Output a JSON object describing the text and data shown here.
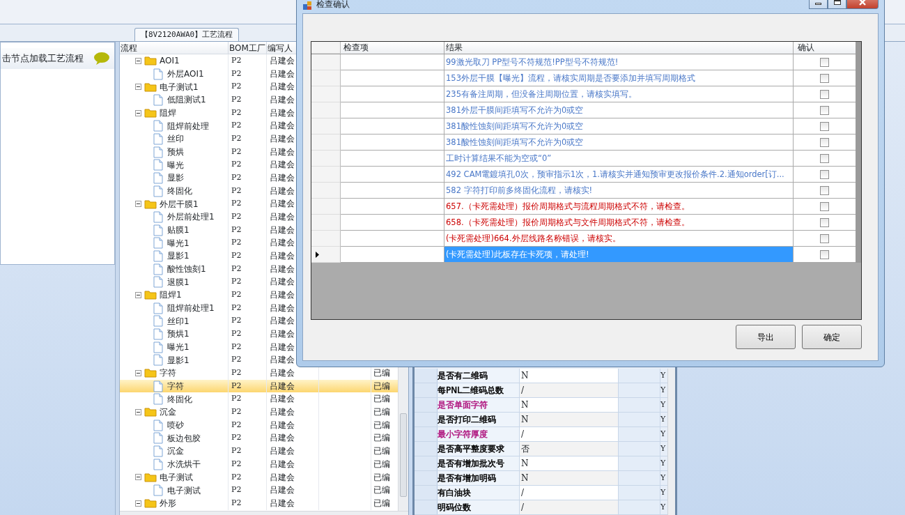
{
  "app": {
    "flow_tab": "【8V2120AWA0】工艺流程",
    "hint": "击节点加载工艺流程"
  },
  "tree": {
    "columns": [
      "流程",
      "BOM工厂",
      "编写人"
    ],
    "rows": [
      {
        "label": "AOI1",
        "factory": "P2",
        "author": "吕建会",
        "expanded": true,
        "children": [
          {
            "label": "外层AOI1",
            "factory": "P2",
            "author": "吕建会",
            "selected": false
          }
        ]
      },
      {
        "label": "电子测试1",
        "factory": "P2",
        "author": "吕建会",
        "expanded": true,
        "children": [
          {
            "label": "低阻测试1",
            "factory": "P2",
            "author": "吕建会",
            "selected": false
          }
        ]
      },
      {
        "label": "阻焊",
        "factory": "P2",
        "author": "吕建会",
        "expanded": true,
        "children": [
          {
            "label": "阻焊前处理",
            "factory": "P2",
            "author": "吕建会",
            "selected": false
          },
          {
            "label": "丝印",
            "factory": "P2",
            "author": "吕建会",
            "selected": false
          },
          {
            "label": "预烘",
            "factory": "P2",
            "author": "吕建会",
            "selected": false
          },
          {
            "label": "曝光",
            "factory": "P2",
            "author": "吕建会",
            "selected": false
          },
          {
            "label": "显影",
            "factory": "P2",
            "author": "吕建会",
            "selected": false
          },
          {
            "label": "终固化",
            "factory": "P2",
            "author": "吕建会",
            "selected": false
          }
        ]
      },
      {
        "label": "外层干膜1",
        "factory": "P2",
        "author": "吕建会",
        "expanded": true,
        "children": [
          {
            "label": "外层前处理1",
            "factory": "P2",
            "author": "吕建会",
            "selected": false
          },
          {
            "label": "贴膜1",
            "factory": "P2",
            "author": "吕建会",
            "selected": false
          },
          {
            "label": "曝光1",
            "factory": "P2",
            "author": "吕建会",
            "selected": false
          },
          {
            "label": "显影1",
            "factory": "P2",
            "author": "吕建会",
            "selected": false
          },
          {
            "label": "酸性蚀刻1",
            "factory": "P2",
            "author": "吕建会",
            "selected": false
          },
          {
            "label": "退膜1",
            "factory": "P2",
            "author": "吕建会",
            "selected": false
          }
        ]
      },
      {
        "label": "阻焊1",
        "factory": "P2",
        "author": "吕建会",
        "expanded": true,
        "children": [
          {
            "label": "阻焊前处理1",
            "factory": "P2",
            "author": "吕建会",
            "selected": false
          },
          {
            "label": "丝印1",
            "factory": "P2",
            "author": "吕建会",
            "selected": false
          },
          {
            "label": "预烘1",
            "factory": "P2",
            "author": "吕建会",
            "selected": false
          },
          {
            "label": "曝光1",
            "factory": "P2",
            "author": "吕建会",
            "selected": false
          },
          {
            "label": "显影1",
            "factory": "P2",
            "author": "吕建会",
            "selected": false
          }
        ]
      },
      {
        "label": "字符",
        "factory": "P2",
        "author": "吕建会",
        "status": "已编",
        "expanded": true,
        "children": [
          {
            "label": "字符",
            "factory": "P2",
            "author": "吕建会",
            "status": "已编",
            "selected": true
          },
          {
            "label": "终固化",
            "factory": "P2",
            "author": "吕建会",
            "status": "已编",
            "selected": false
          }
        ]
      },
      {
        "label": "沉金",
        "factory": "P2",
        "author": "吕建会",
        "status": "已编",
        "expanded": true,
        "children": [
          {
            "label": "喷砂",
            "factory": "P2",
            "author": "吕建会",
            "status": "已编",
            "selected": false
          },
          {
            "label": "板边包胶",
            "factory": "P2",
            "author": "吕建会",
            "status": "已编",
            "selected": false
          },
          {
            "label": "沉金",
            "factory": "P2",
            "author": "吕建会",
            "status": "已编",
            "selected": false
          },
          {
            "label": "水洗烘干",
            "factory": "P2",
            "author": "吕建会",
            "status": "已编",
            "selected": false
          }
        ]
      },
      {
        "label": "电子测试",
        "factory": "P2",
        "author": "吕建会",
        "status": "已编",
        "expanded": true,
        "children": [
          {
            "label": "电子测试",
            "factory": "P2",
            "author": "吕建会",
            "status": "已编",
            "selected": false
          }
        ]
      },
      {
        "label": "外形",
        "factory": "P2",
        "author": "吕建会",
        "status": "已编",
        "expanded": true,
        "children": []
      }
    ]
  },
  "property_grid": {
    "rows": [
      {
        "name": "是否有二维码",
        "value": "N",
        "flag": "Y",
        "color": "#000000"
      },
      {
        "name": "每PNL二维码总数",
        "value": "/",
        "flag": "Y",
        "color": "#000000"
      },
      {
        "name": "是否单面字符",
        "value": "N",
        "flag": "Y",
        "color": "#b01880"
      },
      {
        "name": "是否打印二维码",
        "value": "N",
        "flag": "Y",
        "color": "#000000"
      },
      {
        "name": "最小字符厚度",
        "value": "/",
        "flag": "Y",
        "color": "#b01880"
      },
      {
        "name": "是否高平整度要求",
        "value": "否",
        "flag": "Y",
        "color": "#000000"
      },
      {
        "name": "是否有增加批次号",
        "value": "N",
        "flag": "Y",
        "color": "#000000"
      },
      {
        "name": "是否有增加明码",
        "value": "N",
        "flag": "Y",
        "color": "#000000"
      },
      {
        "name": "有白油块",
        "value": "/",
        "flag": "Y",
        "color": "#000000"
      },
      {
        "name": "明码位数",
        "value": "/",
        "flag": "Y",
        "color": "#000000"
      }
    ]
  },
  "dialog": {
    "title": "检查确认",
    "columns": [
      "检查项",
      "结果",
      "确认"
    ],
    "rows": [
      {
        "result": "99激光取刀 PP型号不符规范!PP型号不符规范!",
        "color": "#4a78c8",
        "checked": false,
        "selected": false
      },
      {
        "result": "153外层干膜【曝光】流程，请核实周期是否要添加并填写周期格式",
        "color": "#4a78c8",
        "checked": false,
        "selected": false
      },
      {
        "result": "235有备注周期，但没备注周期位置，请核实填写。",
        "color": "#4a78c8",
        "checked": false,
        "selected": false
      },
      {
        "result": "381外层干膜间距填写不允许为0或空",
        "color": "#4a78c8",
        "checked": false,
        "selected": false
      },
      {
        "result": "381酸性蚀刻间距填写不允许为0或空",
        "color": "#4a78c8",
        "checked": false,
        "selected": false
      },
      {
        "result": "381酸性蚀刻间距填写不允许为0或空",
        "color": "#4a78c8",
        "checked": false,
        "selected": false
      },
      {
        "result": "工时计算结果不能为空或“0”",
        "color": "#4a78c8",
        "checked": false,
        "selected": false
      },
      {
        "result": "492 CAM電鍍填孔0次，预审指示1次，1.请核实并通知预审更改报价条件.2.通知order[订...",
        "color": "#4a78c8",
        "checked": false,
        "selected": false
      },
      {
        "result": "582 字符打印前多终固化流程，请核实!",
        "color": "#4a78c8",
        "checked": false,
        "selected": false
      },
      {
        "result": "657.（卡死需处理）报价周期格式与流程周期格式不符，请检查。",
        "color": "#cc0000",
        "checked": false,
        "selected": false
      },
      {
        "result": "658.（卡死需处理）报价周期格式与文件周期格式不符，请检查。",
        "color": "#cc0000",
        "checked": false,
        "selected": false
      },
      {
        "result": "(卡死需处理)664.外层线路名称错误，请核实。",
        "color": "#cc0000",
        "checked": false,
        "selected": false
      },
      {
        "result": "(卡死需处理)此板存在卡死项，请处理!",
        "checked": false,
        "selected": true
      }
    ],
    "buttons": [
      "导出",
      "确定"
    ]
  }
}
